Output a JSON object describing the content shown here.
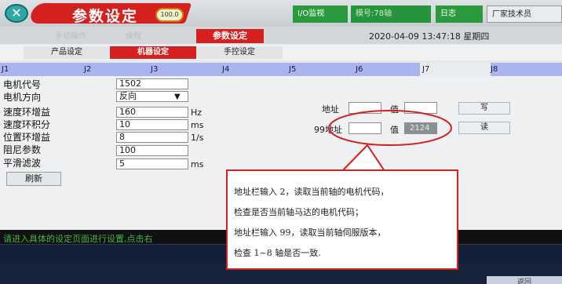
{
  "header": {
    "logo_glyph": "✕",
    "title": "参数设定",
    "version": "100.0",
    "io_monitor": "I/O监视",
    "model": "模号:78轴",
    "log": "日志",
    "vendor": "厂家技术员"
  },
  "nav": {
    "ghost_tabs": [
      "手动操作",
      "编程"
    ],
    "active_section": "参数设定",
    "datetime": "2020-04-09 13:47:18 星期四"
  },
  "sub_tabs": [
    "产品设定",
    "机器设定",
    "手控设定"
  ],
  "axes": [
    "J1",
    "J2",
    "J3",
    "J4",
    "J5",
    "J6",
    "J7",
    "J8"
  ],
  "params": [
    {
      "label": "电机代号",
      "value": "1502",
      "unit": ""
    },
    {
      "label": "电机方向",
      "value": "反向",
      "unit": ""
    },
    {
      "label": "速度环增益",
      "value": "160",
      "unit": "Hz"
    },
    {
      "label": "速度环积分",
      "value": "10",
      "unit": "ms"
    },
    {
      "label": "位置环增益",
      "value": "8",
      "unit": "1/s"
    },
    {
      "label": "阻尼参数",
      "value": "100",
      "unit": ""
    },
    {
      "label": "平滑滤波",
      "value": "5",
      "unit": "ms"
    }
  ],
  "refresh": "刷新",
  "address": {
    "addr_label_1": "地址",
    "value_label": "值",
    "write_btn": "写",
    "addr_label_2": "99地址",
    "read_btn": "读",
    "value_2": "2124"
  },
  "status": "请进入具体的设定页面进行设置,点击右",
  "back": "返回",
  "annotation": [
    "地址栏输入 2，读取当前轴的电机代码，",
    "检查是否当前轴马达的电机代码；",
    "地址栏输入 99，读取当前轴伺服版本，",
    "检查 1~8 轴是否一致."
  ]
}
